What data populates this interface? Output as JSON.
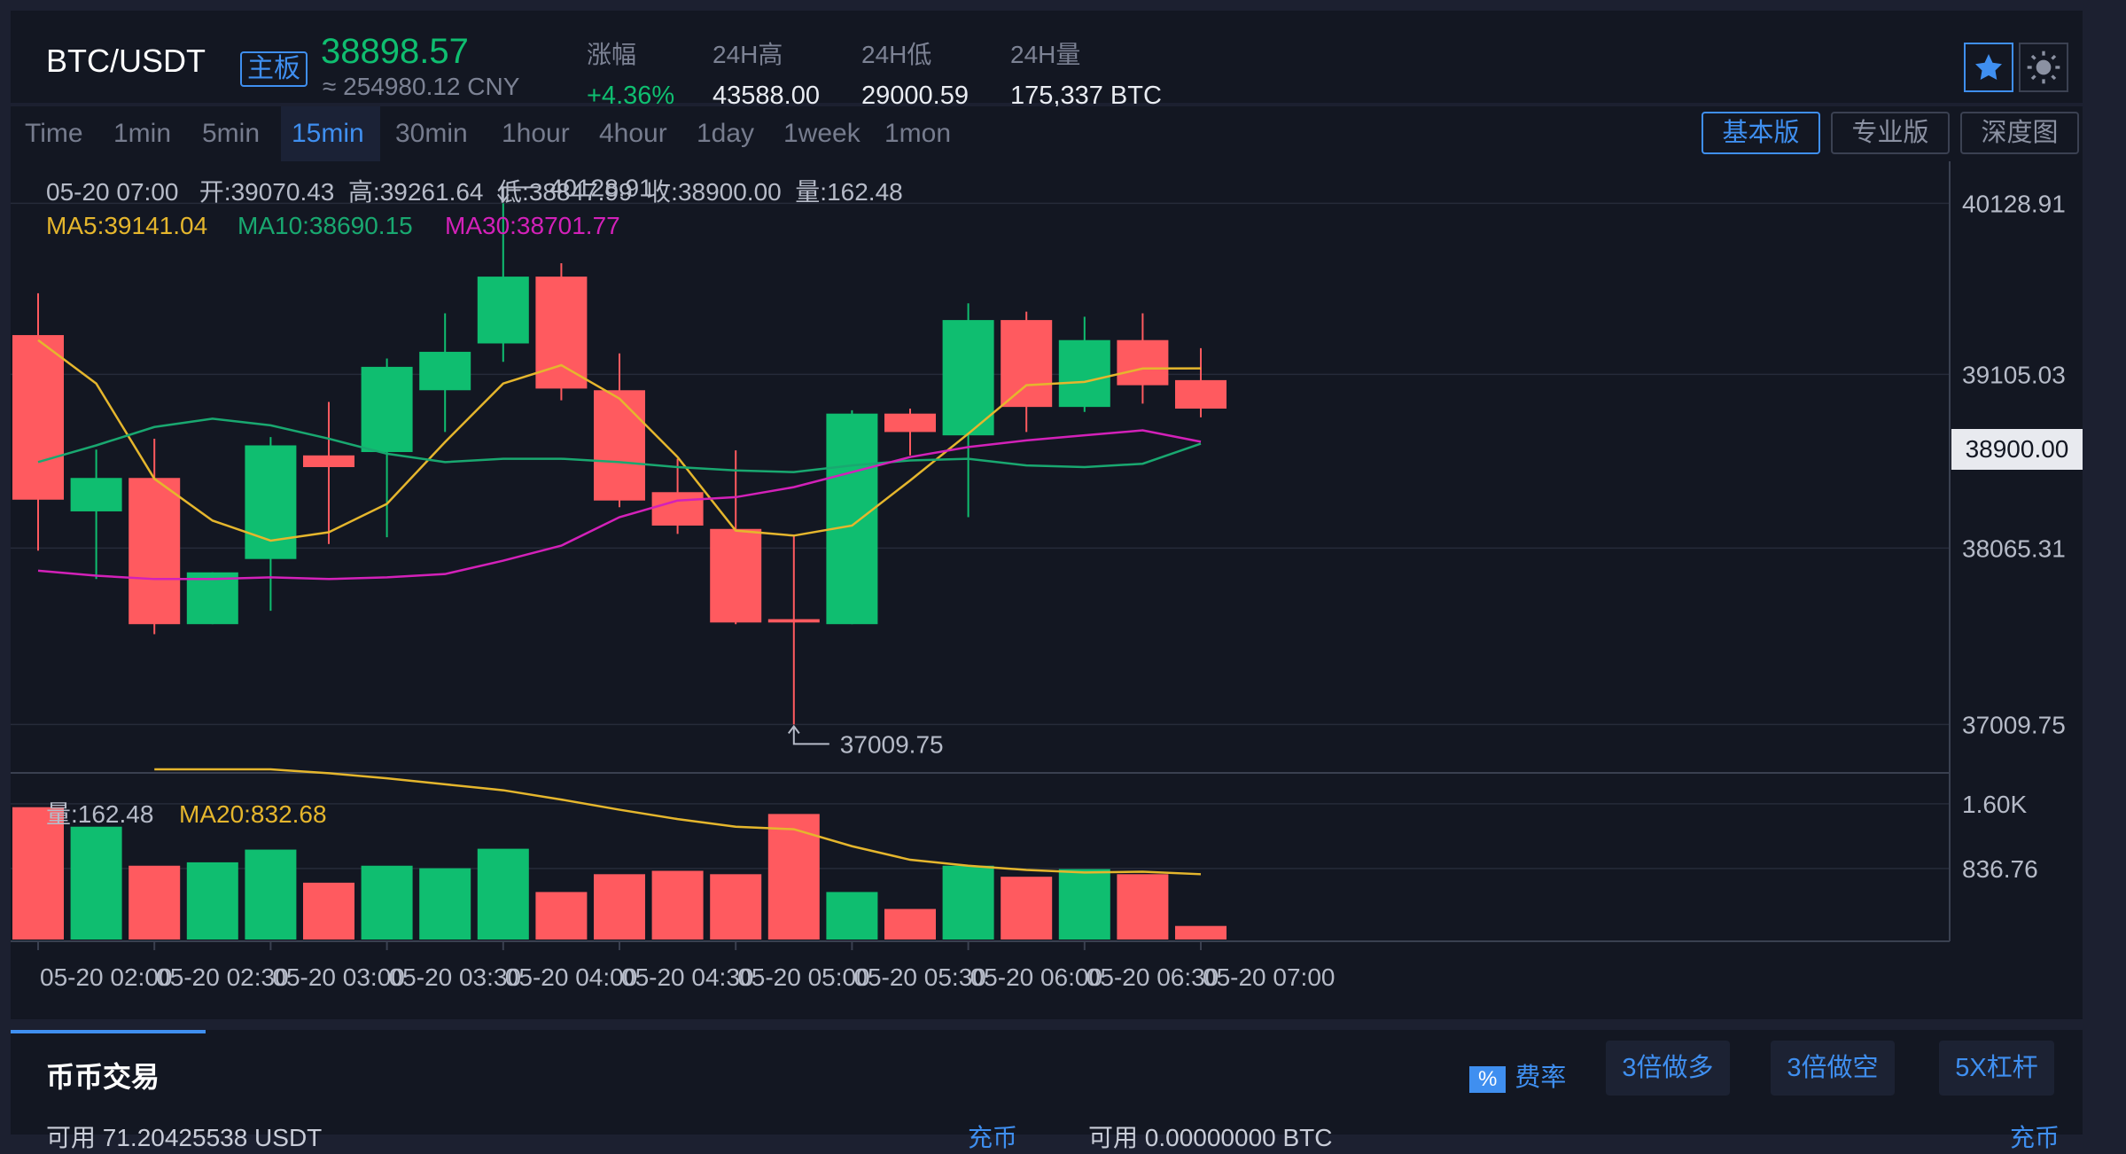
{
  "header": {
    "pair": "BTC/USDT",
    "board_tag": "主板",
    "last_price": "38898.57",
    "cny_price": "≈ 254980.12 CNY",
    "stats": [
      {
        "label": "涨幅",
        "value": "+4.36%",
        "up": true
      },
      {
        "label": "24H高",
        "value": "43588.00"
      },
      {
        "label": "24H低",
        "value": "29000.59"
      },
      {
        "label": "24H量",
        "value": "175,337 BTC"
      }
    ],
    "icons": [
      "star-icon",
      "sun-icon"
    ]
  },
  "toolbar": {
    "intervals": [
      "Time",
      "1min",
      "5min",
      "15min",
      "30min",
      "1hour",
      "4hour",
      "1day",
      "1week",
      "1mon"
    ],
    "active_interval": "15min",
    "views": [
      "基本版",
      "专业版",
      "深度图"
    ],
    "active_view": "基本版"
  },
  "chart_data": {
    "type": "candlestick",
    "info_line": "05-20 07:00   开:39070.43  高:39261.64  低:38847.99  收:38900.00  量:162.48",
    "ma_legend": {
      "ma5": "MA5:39141.04",
      "ma10": "MA10:38690.15",
      "ma30": "MA30:38701.77"
    },
    "x": [
      "05-20 02:00",
      "",
      "05-20 02:30",
      "",
      "05-20 03:00",
      "",
      "05-20 03:30",
      "",
      "05-20 04:00",
      "",
      "05-20 04:30",
      "",
      "05-20 05:00",
      "",
      "05-20 05:30",
      "",
      "05-20 06:00",
      "",
      "05-20 06:30",
      "",
      "05-20 07:00"
    ],
    "x_tick_labels": [
      "05-20 02:00",
      "05-20 02:30",
      "05-20 03:00",
      "05-20 03:30",
      "05-20 04:00",
      "05-20 04:30",
      "05-20 05:00",
      "05-20 05:30",
      "05-20 06:00",
      "05-20 06:30",
      "05-20 07:00"
    ],
    "candles": [
      {
        "o": 39340,
        "h": 39590,
        "l": 38050,
        "c": 38355
      },
      {
        "o": 38285,
        "h": 38655,
        "l": 37880,
        "c": 38485
      },
      {
        "o": 38485,
        "h": 38720,
        "l": 37550,
        "c": 37610
      },
      {
        "o": 37610,
        "h": 37920,
        "l": 37610,
        "c": 37920
      },
      {
        "o": 38000,
        "h": 38730,
        "l": 37690,
        "c": 38680
      },
      {
        "o": 38620,
        "h": 38940,
        "l": 38090,
        "c": 38550
      },
      {
        "o": 38640,
        "h": 39200,
        "l": 38130,
        "c": 39150
      },
      {
        "o": 39010,
        "h": 39470,
        "l": 38760,
        "c": 39240
      },
      {
        "o": 39290,
        "h": 40128.91,
        "l": 39180,
        "c": 39690
      },
      {
        "o": 39690,
        "h": 39770,
        "l": 38950,
        "c": 39020
      },
      {
        "o": 39010,
        "h": 39230,
        "l": 38310,
        "c": 38350
      },
      {
        "o": 38400,
        "h": 38600,
        "l": 38150,
        "c": 38200
      },
      {
        "o": 38180,
        "h": 38650,
        "l": 37610,
        "c": 37620
      },
      {
        "o": 37640,
        "h": 38140,
        "l": 37009.75,
        "c": 37620
      },
      {
        "o": 37610,
        "h": 38890,
        "l": 37610,
        "c": 38870
      },
      {
        "o": 38870,
        "h": 38900,
        "l": 38620,
        "c": 38760
      },
      {
        "o": 38740,
        "h": 39530,
        "l": 38250,
        "c": 39430
      },
      {
        "o": 39430,
        "h": 39480,
        "l": 38760,
        "c": 38910
      },
      {
        "o": 38910,
        "h": 39450,
        "l": 38880,
        "c": 39310
      },
      {
        "o": 39310,
        "h": 39470,
        "l": 38930,
        "c": 39040
      },
      {
        "o": 39070.43,
        "h": 39261.64,
        "l": 38847.99,
        "c": 38900.0
      }
    ],
    "ma5": [
      39310,
      39050,
      38480,
      38230,
      38110,
      38160,
      38330,
      38700,
      39050,
      39160,
      38960,
      38610,
      38170,
      38140,
      38200,
      38470,
      38750,
      39040,
      39060,
      39140,
      39141.04
    ],
    "ma10": [
      38580,
      38680,
      38790,
      38840,
      38800,
      38720,
      38630,
      38580,
      38600,
      38600,
      38580,
      38550,
      38530,
      38520,
      38560,
      38590,
      38600,
      38560,
      38550,
      38570,
      38690.15
    ],
    "ma30": [
      37930,
      37900,
      37880,
      37880,
      37890,
      37880,
      37890,
      37910,
      37990,
      38080,
      38250,
      38350,
      38370,
      38430,
      38520,
      38610,
      38670,
      38710,
      38740,
      38770,
      38701.77
    ],
    "y_ticks": [
      "40128.91",
      "39105.03",
      "38065.31",
      "37009.75"
    ],
    "y_range": [
      36720,
      40380
    ],
    "max_label": "40128.91",
    "min_label": "37009.75",
    "current_price_tag": "38900.00",
    "volume": {
      "legend_vol": "量:162.48",
      "legend_ma20": "MA20:832.68",
      "values": [
        1560,
        1330,
        870,
        910,
        1060,
        670,
        870,
        840,
        1070,
        560,
        770,
        810,
        770,
        1480,
        560,
        360,
        870,
        740,
        830,
        770,
        160
      ],
      "ma20": [
        null,
        null,
        2480,
        2180,
        2020,
        1960,
        1900,
        1830,
        1760,
        1650,
        1530,
        1420,
        1330,
        1300,
        1100,
        940,
        870,
        820,
        790,
        800,
        770
      ],
      "y_ticks": [
        "1.60K",
        "836.76"
      ],
      "y_max": 1860
    }
  },
  "bottom": {
    "tab": "币币交易",
    "fee_icon": "%",
    "fee_label": "费率",
    "buttons": [
      "3倍做多",
      "3倍做空",
      "5X杠杆"
    ],
    "avail_left": "可用 71.20425538 USDT",
    "avail_right": "可用 0.00000000 BTC",
    "transfer_left": "充币",
    "transfer_right": "充币"
  },
  "colors": {
    "up": "#0fbe70",
    "down": "#ff5a5f",
    "ma5": "#e5b62d",
    "ma10": "#19a870",
    "ma30": "#d321b9",
    "accent": "#3f8ff0"
  }
}
